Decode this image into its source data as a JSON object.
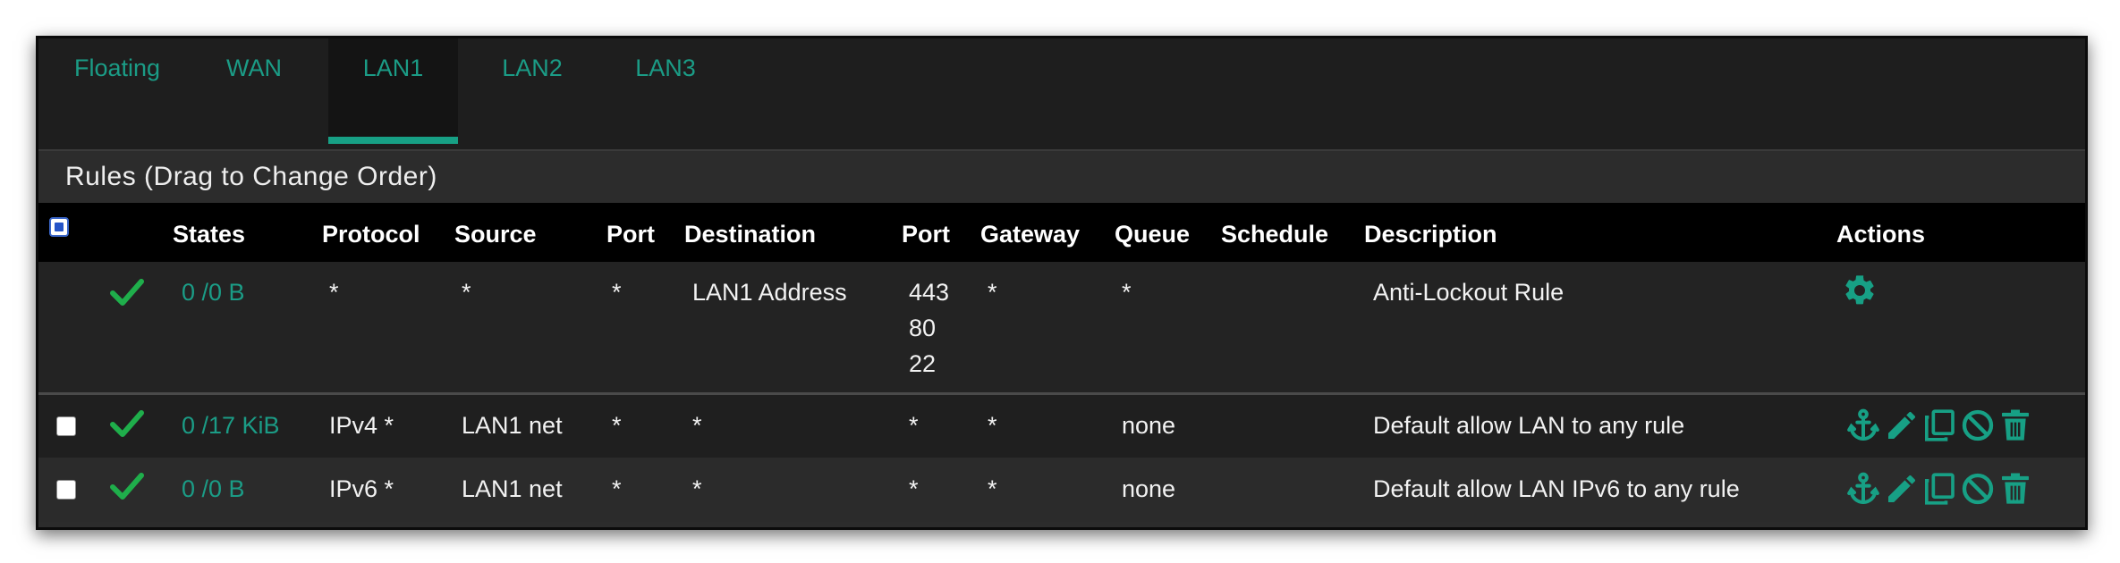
{
  "tabs": [
    "Floating",
    "WAN",
    "LAN1",
    "LAN2",
    "LAN3"
  ],
  "active_tab": "LAN1",
  "panel": {
    "title": "Rules (Drag to Change Order)"
  },
  "table": {
    "headers": {
      "states": "States",
      "protocol": "Protocol",
      "source": "Source",
      "source_port": "Port",
      "destination": "Destination",
      "dest_port": "Port",
      "gateway": "Gateway",
      "queue": "Queue",
      "schedule": "Schedule",
      "description": "Description",
      "actions": "Actions"
    },
    "rows": [
      {
        "states": "0 /0 B",
        "protocol": "*",
        "source": "*",
        "source_port": "*",
        "destination": "LAN1 Address",
        "dest_port": [
          "443",
          "80",
          "22"
        ],
        "gateway": "*",
        "queue": "*",
        "schedule": "",
        "description": "Anti-Lockout Rule",
        "actions": [
          "gear-icon"
        ]
      },
      {
        "states": "0 /17 KiB",
        "protocol": "IPv4 *",
        "source": "LAN1 net",
        "source_port": "*",
        "destination": "*",
        "dest_port": [
          "*"
        ],
        "gateway": "*",
        "queue": "none",
        "schedule": "",
        "description": "Default allow LAN to any rule",
        "actions": [
          "anchor-icon",
          "pencil-icon",
          "copy-icon",
          "disable-icon",
          "trash-icon"
        ]
      },
      {
        "states": "0 /0 B",
        "protocol": "IPv6 *",
        "source": "LAN1 net",
        "source_port": "*",
        "destination": "*",
        "dest_port": [
          "*"
        ],
        "gateway": "*",
        "queue": "none",
        "schedule": "",
        "description": "Default allow LAN IPv6 to any rule",
        "actions": [
          "anchor-icon",
          "pencil-icon",
          "copy-icon",
          "disable-icon",
          "trash-icon"
        ]
      }
    ]
  },
  "colors": {
    "accent": "#17a085",
    "pass_check": "#1fae4b",
    "header_bg": "#000000",
    "panel_bg": "#2c2c2c"
  }
}
